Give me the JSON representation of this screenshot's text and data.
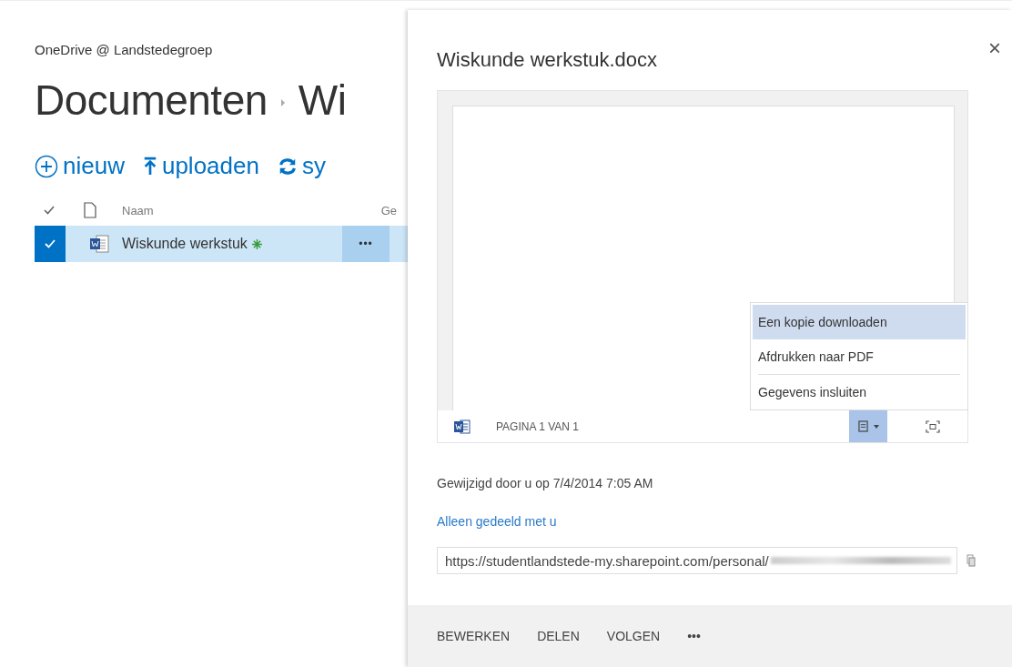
{
  "site": "OneDrive @ Landstedegroep",
  "breadcrumb": [
    "Documenten",
    "Wi"
  ],
  "toolbar": [
    {
      "kind": "new",
      "label": "nieuw"
    },
    {
      "kind": "upload",
      "label": "uploaden"
    },
    {
      "kind": "sync",
      "label": "sy"
    }
  ],
  "list": {
    "columns": [
      "Naam",
      "Ge"
    ],
    "rows": [
      {
        "name": "Wiskunde werkstuk",
        "selected": true,
        "new": true,
        "menu": "•••"
      }
    ]
  },
  "panel": {
    "title": "Wiskunde werkstuk.docx",
    "close": "×",
    "preview": {
      "page": "PAGINA 1 VAN 1",
      "menu_open": true,
      "menu": [
        {
          "label": "Een kopie downloaden",
          "selected": true
        },
        {
          "label": "Afdrukken naar PDF",
          "selected": false
        },
        {
          "label": "Gegevens insluiten",
          "selected": false
        }
      ]
    },
    "modified": "Gewijzigd door u op 7/4/2014 7:05 AM",
    "sharing": "Alleen gedeeld met u",
    "url": "https://studentlandstede-my.sharepoint.com/personal/",
    "actions": [
      "BEWERKEN",
      "DELEN",
      "VOLGEN",
      "•••"
    ]
  }
}
